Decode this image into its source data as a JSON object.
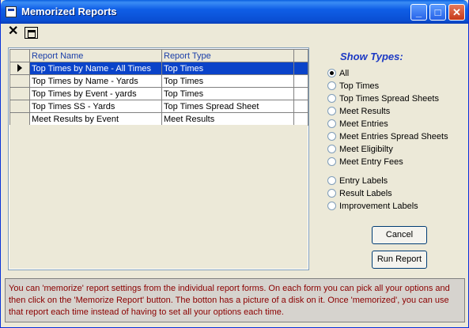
{
  "window": {
    "title": "Memorized Reports"
  },
  "grid": {
    "headers": [
      "Report Name",
      "Report Type"
    ],
    "rows": [
      {
        "name": "Top Times by Name - All Times",
        "type": "Top Times"
      },
      {
        "name": "Top Times by Name - Yards",
        "type": "Top Times"
      },
      {
        "name": "Top Times by Event - yards",
        "type": "Top Times"
      },
      {
        "name": "Top Times SS - Yards",
        "type": "Top Times Spread Sheet"
      },
      {
        "name": "Meet Results by Event",
        "type": "Meet Results"
      }
    ]
  },
  "show_types": {
    "title": "Show Types:",
    "options": [
      "All",
      "Top Times",
      "Top Times Spread Sheets",
      "Meet Results",
      "Meet Entries",
      "Meet Entries Spread Sheets",
      "Meet Eligibilty",
      "Meet Entry Fees",
      "Entry Labels",
      "Result Labels",
      "Improvement Labels"
    ],
    "selected": "All"
  },
  "buttons": {
    "cancel": "Cancel",
    "run": "Run Report"
  },
  "info": "You can 'memorize' report settings from the individual report forms.  On each form you can pick all your options and then click on the 'Memorize Report' button. The botton has a picture of a disk on it.  Once 'memorized', you can use that report each time instead of having to set all your options each time."
}
